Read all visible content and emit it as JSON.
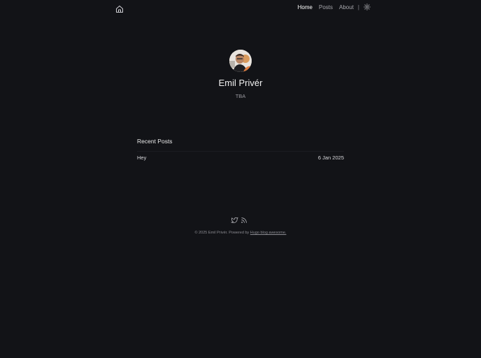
{
  "header": {
    "nav": [
      {
        "label": "Home",
        "active": true
      },
      {
        "label": "Posts",
        "active": false
      },
      {
        "label": "About",
        "active": false
      }
    ],
    "separator": "|",
    "home_icon": "home-icon",
    "theme_icon": "sun-icon"
  },
  "profile": {
    "name": "Emil Privér",
    "tagline": "TBA"
  },
  "recent_posts": {
    "title": "Recent Posts",
    "items": [
      {
        "title": "Hey",
        "date": "6 Jan 2025"
      }
    ]
  },
  "footer": {
    "icons": [
      "twitter-icon",
      "rss-icon"
    ],
    "copyright_prefix": "© 2025 Emil Privér. Powered by ",
    "powered_by_link": "Hugo blog awesome."
  },
  "colors": {
    "background": "#121317",
    "text_primary": "#f2f2f2",
    "text_muted": "#9a9aa0",
    "accent_avatar": "#d8d0c8"
  }
}
